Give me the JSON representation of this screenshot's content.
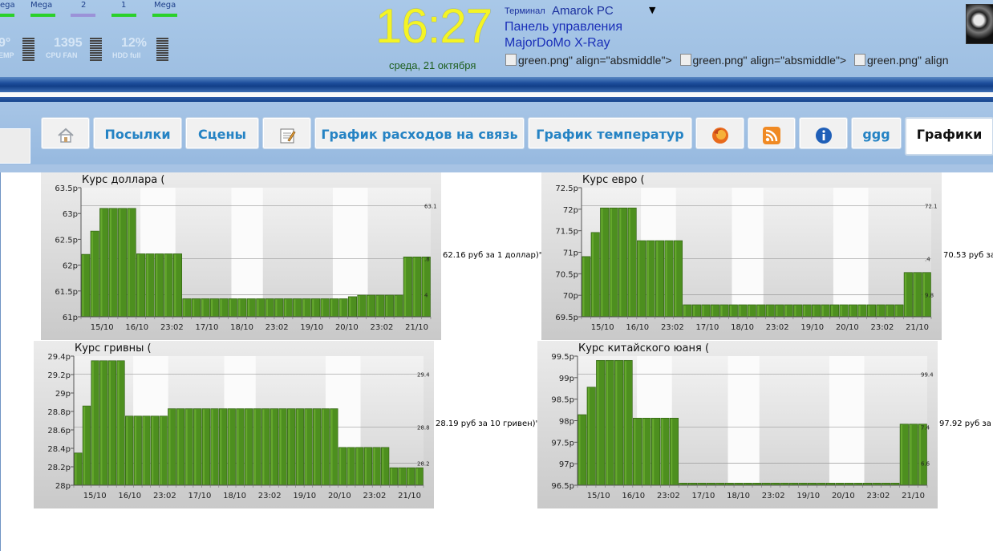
{
  "header": {
    "network": [
      {
        "label": "ega",
        "color": "#2ad12a"
      },
      {
        "label": "Mega",
        "color": "#2ad12a"
      },
      {
        "label": "2",
        "color": "#9b92d8"
      },
      {
        "label": "1",
        "color": "#2ad12a"
      },
      {
        "label": "Mega",
        "color": "#2ad12a"
      }
    ],
    "stats": [
      {
        "value": "9°",
        "label": "EMP"
      },
      {
        "value": "1395",
        "label": "CPU FAN"
      },
      {
        "value": "12%",
        "label": "HDD full"
      }
    ],
    "clock": "16:27",
    "date": "среда, 21 октября",
    "terminal_label": "Терминал",
    "terminal_value": "Amarok PC",
    "terminal_dropdown": "▼",
    "panel_link": "Панель управления",
    "xray_link": "MajorDoMo X-Ray",
    "broken_images": [
      "green.png\" align=\"absmiddle\">",
      "green.png\" align=\"absmiddle\">",
      "green.png\" align"
    ],
    "avatar_icon": "user-avatar"
  },
  "tabs": [
    {
      "kind": "icon",
      "icon": "home-icon"
    },
    {
      "kind": "text",
      "label": "Посылки"
    },
    {
      "kind": "text",
      "label": "Сцены"
    },
    {
      "kind": "icon",
      "icon": "notepad-icon"
    },
    {
      "kind": "text",
      "label": "График расходов на связь"
    },
    {
      "kind": "text",
      "label": "График температур"
    },
    {
      "kind": "icon",
      "icon": "firefox-icon"
    },
    {
      "kind": "icon",
      "icon": "rss-icon"
    },
    {
      "kind": "icon",
      "icon": "info-icon"
    },
    {
      "kind": "text",
      "label": "ggg"
    },
    {
      "kind": "text",
      "label": "Графики",
      "active": true
    }
  ],
  "chart_data": [
    {
      "type": "bar",
      "title": "Курс доллара (",
      "right_text": "62.16 руб за 1 доллар)\">",
      "ylim": [
        61,
        63.5
      ],
      "yticks": [
        "61p",
        "61.5p",
        "62p",
        "62.5p",
        "63p",
        "63.5p"
      ],
      "right_ticks": [
        "63.1",
        ".8",
        "4"
      ],
      "xlabels": [
        "15/10",
        "16/10",
        "23:02",
        "17/10",
        "18/10",
        "23:02",
        "19/10",
        "20/10",
        "23:02",
        "21/10"
      ],
      "values": [
        62.21,
        62.66,
        63.1,
        63.1,
        63.1,
        63.1,
        62.22,
        62.22,
        62.22,
        62.22,
        62.22,
        61.35,
        61.35,
        61.35,
        61.35,
        61.35,
        61.35,
        61.35,
        61.35,
        61.35,
        61.35,
        61.35,
        61.35,
        61.35,
        61.35,
        61.35,
        61.35,
        61.35,
        61.35,
        61.39,
        61.42,
        61.42,
        61.42,
        61.42,
        61.42,
        62.16,
        62.16,
        62.16
      ]
    },
    {
      "type": "bar",
      "title": "Курс евро (",
      "right_text": "70.53 руб за",
      "ylim": [
        69.5,
        72.5
      ],
      "yticks": [
        "69.5p",
        "70p",
        "70.5p",
        "71p",
        "71.5p",
        "72p",
        "72.5p"
      ],
      "right_ticks": [
        "72.1",
        ".4",
        "9.8"
      ],
      "xlabels": [
        "15/10",
        "16/10",
        "23:02",
        "17/10",
        "18/10",
        "23:02",
        "19/10",
        "20/10",
        "23:02",
        "21/10"
      ],
      "values": [
        70.9,
        71.46,
        72.03,
        72.03,
        72.03,
        72.03,
        71.27,
        71.27,
        71.27,
        71.27,
        71.27,
        69.78,
        69.78,
        69.78,
        69.78,
        69.78,
        69.78,
        69.78,
        69.78,
        69.78,
        69.78,
        69.78,
        69.78,
        69.78,
        69.78,
        69.78,
        69.78,
        69.78,
        69.78,
        69.78,
        69.78,
        69.78,
        69.78,
        69.78,
        69.78,
        70.53,
        70.53,
        70.53
      ]
    },
    {
      "type": "bar",
      "title": "Курс гривны (",
      "right_text": "28.19 руб за 10 гривен)\">",
      "ylim": [
        28,
        29.4
      ],
      "yticks": [
        "28p",
        "28.2p",
        "28.4p",
        "28.6p",
        "28.8p",
        "29p",
        "29.2p",
        "29.4p"
      ],
      "right_ticks": [
        "29.4",
        "28.8",
        "28.2"
      ],
      "xlabels": [
        "15/10",
        "16/10",
        "23:02",
        "17/10",
        "18/10",
        "23:02",
        "19/10",
        "20/10",
        "23:02",
        "21/10"
      ],
      "values": [
        28.35,
        28.86,
        29.35,
        29.35,
        29.35,
        29.35,
        28.75,
        28.75,
        28.75,
        28.75,
        28.75,
        28.83,
        28.83,
        28.83,
        28.83,
        28.83,
        28.83,
        28.83,
        28.83,
        28.83,
        28.83,
        28.83,
        28.83,
        28.83,
        28.83,
        28.83,
        28.83,
        28.83,
        28.83,
        28.83,
        28.83,
        28.41,
        28.41,
        28.41,
        28.41,
        28.41,
        28.41,
        28.19,
        28.19,
        28.19,
        28.19
      ]
    },
    {
      "type": "bar",
      "title": "Курс китайского юаня (",
      "right_text": "97.92 руб за 1",
      "ylim": [
        96.5,
        99.5
      ],
      "yticks": [
        "96.5p",
        "97p",
        "97.5p",
        "98p",
        "98.5p",
        "99p",
        "99.5p"
      ],
      "right_ticks": [
        "99.4",
        "7.4",
        "6.6"
      ],
      "xlabels": [
        "15/10",
        "16/10",
        "23:02",
        "17/10",
        "18/10",
        "23:02",
        "19/10",
        "20/10",
        "23:02",
        "21/10"
      ],
      "values": [
        98.14,
        98.78,
        99.4,
        99.4,
        99.4,
        99.4,
        98.06,
        98.06,
        98.06,
        98.06,
        98.06,
        96.55,
        96.55,
        96.55,
        96.55,
        96.55,
        96.55,
        96.55,
        96.55,
        96.55,
        96.55,
        96.55,
        96.55,
        96.55,
        96.55,
        96.55,
        96.55,
        96.55,
        96.55,
        96.55,
        96.55,
        96.55,
        96.55,
        96.55,
        96.55,
        97.92,
        97.92,
        97.92
      ]
    }
  ]
}
